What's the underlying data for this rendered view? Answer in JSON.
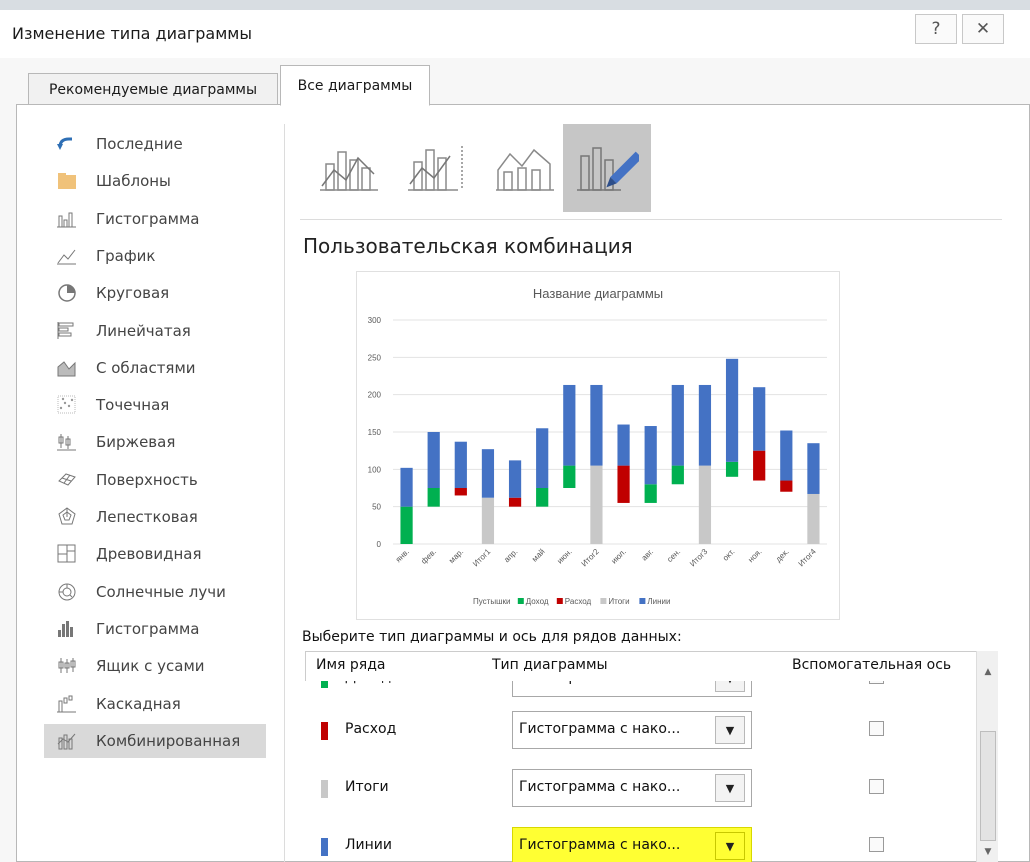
{
  "window": {
    "title": "Изменение типа диаграммы",
    "help_glyph": "?",
    "close_glyph": "✕"
  },
  "tabs": [
    {
      "label": "Рекомендуемые диаграммы",
      "active": false
    },
    {
      "label": "Все диаграммы",
      "active": true
    }
  ],
  "categories": [
    {
      "label": "Последние",
      "icon": "undo-icon"
    },
    {
      "label": "Шаблоны",
      "icon": "folder-icon"
    },
    {
      "label": "Гистограмма",
      "icon": "column-chart-icon"
    },
    {
      "label": "График",
      "icon": "line-chart-icon"
    },
    {
      "label": "Круговая",
      "icon": "pie-chart-icon"
    },
    {
      "label": "Линейчатая",
      "icon": "bar-chart-icon"
    },
    {
      "label": "С областями",
      "icon": "area-chart-icon"
    },
    {
      "label": "Точечная",
      "icon": "scatter-chart-icon"
    },
    {
      "label": "Биржевая",
      "icon": "stock-chart-icon"
    },
    {
      "label": "Поверхность",
      "icon": "surface-chart-icon"
    },
    {
      "label": "Лепестковая",
      "icon": "radar-chart-icon"
    },
    {
      "label": "Древовидная",
      "icon": "treemap-icon"
    },
    {
      "label": "Солнечные лучи",
      "icon": "sunburst-icon"
    },
    {
      "label": "Гистограмма",
      "icon": "histogram-icon"
    },
    {
      "label": "Ящик с усами",
      "icon": "box-whisker-icon"
    },
    {
      "label": "Каскадная",
      "icon": "waterfall-icon"
    },
    {
      "label": "Комбинированная",
      "icon": "combo-chart-icon",
      "selected": true
    }
  ],
  "combo_types": [
    {
      "icon": "column-line-icon",
      "selected": false
    },
    {
      "icon": "column-line-secondary-axis-icon",
      "selected": false
    },
    {
      "icon": "area-column-icon",
      "selected": false
    },
    {
      "icon": "custom-combo-icon",
      "selected": true
    }
  ],
  "subtitle": "Пользовательская комбинация",
  "select_label": "Выберите тип диаграммы и ось для рядов данных:",
  "grid": {
    "col_series": "Имя ряда",
    "col_type": "Тип диаграммы",
    "col_axis": "Вспомогательная ось",
    "rows": [
      {
        "name": "Доход",
        "color": "#00b050",
        "type": "Гистограмма с нако...",
        "secondary": false
      },
      {
        "name": "Расход",
        "color": "#c00000",
        "type": "Гистограмма с нако...",
        "secondary": false
      },
      {
        "name": "Итоги",
        "color": "#c8c8c8",
        "type": "Гистограмма с нако...",
        "secondary": false
      },
      {
        "name": "Линии",
        "color": "#4472c4",
        "type": "Гистограмма с нако...",
        "secondary": false,
        "highlighted": true
      }
    ]
  },
  "colors": {
    "highlight": "#ffff33"
  },
  "chart_data": {
    "type": "bar",
    "stacked": true,
    "title": "Название диаграммы",
    "categories": [
      "янв.",
      "фев.",
      "мар.",
      "Итог1",
      "апр.",
      "май",
      "июн.",
      "Итог2",
      "июл.",
      "авг.",
      "сен.",
      "Итог3",
      "окт.",
      "ноя.",
      "дек.",
      "Итог4"
    ],
    "ylim": [
      0,
      300
    ],
    "yticks": [
      0,
      50,
      100,
      150,
      200,
      250,
      300
    ],
    "grid": true,
    "legend_position": "bottom",
    "series": [
      {
        "name": "Пустышки",
        "color": "none",
        "values": [
          0,
          50,
          65,
          0,
          50,
          50,
          75,
          0,
          55,
          55,
          80,
          0,
          90,
          85,
          70,
          0
        ]
      },
      {
        "name": "Доход",
        "color": "#00b050",
        "values": [
          50,
          25,
          0,
          0,
          0,
          25,
          30,
          0,
          0,
          25,
          25,
          0,
          20,
          0,
          0,
          0
        ]
      },
      {
        "name": "Расход",
        "color": "#c00000",
        "values": [
          0,
          0,
          10,
          0,
          12,
          0,
          0,
          0,
          50,
          0,
          0,
          0,
          0,
          40,
          15,
          0
        ]
      },
      {
        "name": "Итоги",
        "color": "#c8c8c8",
        "values": [
          0,
          0,
          0,
          62,
          0,
          0,
          0,
          105,
          0,
          0,
          0,
          105,
          0,
          0,
          0,
          67
        ]
      },
      {
        "name": "Линии",
        "color": "#4472c4",
        "values": [
          52,
          75,
          62,
          65,
          50,
          80,
          108,
          108,
          55,
          78,
          108,
          108,
          138,
          85,
          67,
          68
        ]
      }
    ]
  }
}
